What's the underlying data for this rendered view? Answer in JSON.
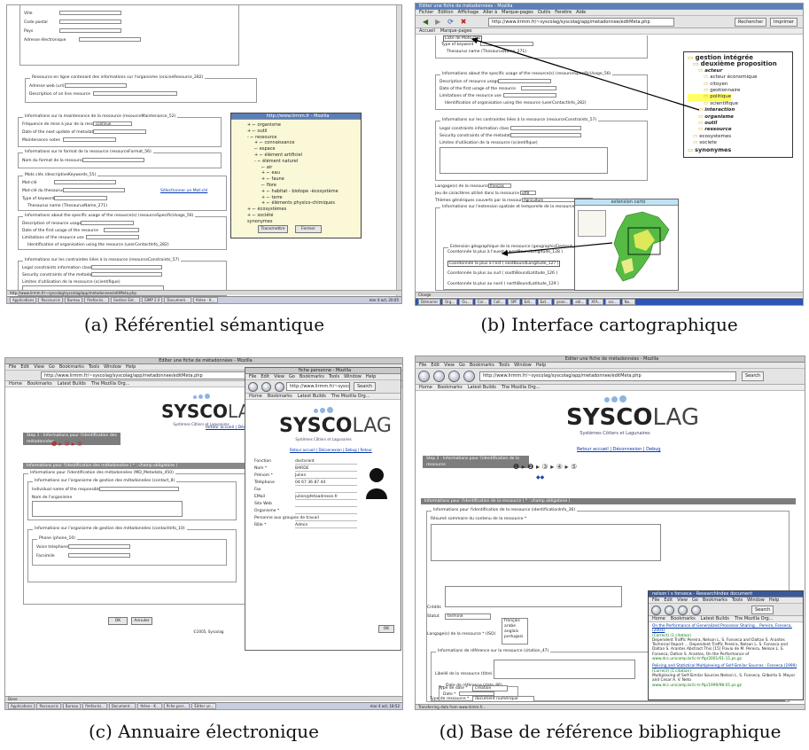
{
  "captions": {
    "a": "(a) Référentiel sémantique",
    "b": "(b) Interface cartographique",
    "c": "(c) Annuaire électronique",
    "d": "(d) Base de référence bibliographique"
  },
  "colors": {
    "link": "#0033aa",
    "titlebar": "#5b7fb8",
    "highlight": "#ffff66",
    "map_green": "#55bb44"
  },
  "browser": {
    "menu": [
      "Fichier",
      "Édition",
      "Affichage",
      "Aller à",
      "Marque-pages",
      "Outils",
      "Fenêtre",
      "Aide"
    ],
    "menu_en": [
      "File",
      "Edit",
      "View",
      "Go",
      "Bookmarks",
      "Tools",
      "Window",
      "Help"
    ],
    "bookmarks": [
      "Home",
      "Bookmarks",
      "Latest Builds",
      "The Mozilla Org..."
    ],
    "search_label": "Search",
    "url_a": "http://www.lirmm.fr/~syscolag/syscolag/app/metadonnee/editMeta.php",
    "url_d": "http://www.lirmm.fr/~syscolag/syscolag/app/metadonnee/editMeta.php"
  },
  "panel_a": {
    "fields_top": [
      "Ville",
      "Code postal",
      "Pays",
      "Adresse électronique"
    ],
    "res_legend": "Ressource en ligne contenant des informations sur l'organisme (onLineResource_282)",
    "res_fields": [
      "Adresse web (url)",
      "Description of on line resource"
    ],
    "maint_legend": "Informations sur la maintenance de la ressource (resourceMaintenance_52)",
    "maint_fields": [
      "Fréquence de mise à jour de la ressource",
      "Date of the next update of metadata",
      "Maintenance notes"
    ],
    "maint_select": "continue",
    "format_legend": "Informations sur le format de la ressource (resourceFormat_56)",
    "format_fields": [
      "Nom du format de la ressource"
    ],
    "kw_legend": "Mots clés (descriptiveKeywords_55)",
    "kw_fields": [
      "Mot-clé",
      "Mot-clé du thesaurus",
      "Type of keyword"
    ],
    "kw_link": "Sélectionner un Mot-clé",
    "thes_legend": "Thesaurus name (ThesaurusName_271)",
    "usage_legend": "Informations about the specific usage of the resource(s) (resourceSpecificUsage_56)",
    "usage_fields": [
      "Description of resource usage",
      "Date of the first usage of the resource",
      "Limitations of the resource use"
    ],
    "contact_legend": "Identification of organisation using the resource (userContactInfo_282)",
    "constr_legend": "Informations sur les contraintes liées à la ressource (resourceConstraints_57)",
    "constr_fields": [
      "Legal constraints information class",
      "Security constraints of the metadata",
      "Limites d'utilisation de la ressource (scientifique)"
    ],
    "popup_title": "http://www.lirmm.fr - Mozilla",
    "tree": [
      "+ ⌐ organisme",
      "+ ⌐ outil",
      "- ⌐ ressource",
      "+ ⌐ connaissance",
      "⌐ espace",
      "+ ⌐ élément artificiel",
      "- ⌐ élément naturel",
      "⌐ air",
      "+ ⌐ eau",
      "+ ⌐ faune",
      "⌐ flore",
      "+ ⌐ habitat - biotope -écosystème",
      "+ ⌐ terre",
      "+ ⌐ éléments physico-chimiques",
      "+ ⌐ écosystèmes",
      "+ ⌐ société",
      "synonymes"
    ],
    "popup_buttons": [
      "Transmettre",
      "Fermer"
    ],
    "taskbar": [
      "Applications",
      "Raccourcis",
      "Bureau",
      "firefox-bi...",
      "Gestion Ext...",
      "GIMP 2.0",
      "Document...",
      "thèse - K..."
    ],
    "clock": "mer 4 oct, 20:05"
  },
  "panel_b": {
    "title": "Éditer une fiche de métadonnées - Mozilla",
    "tb_buttons": [
      "Précédent",
      "Suivant",
      "Actualiser",
      "Arrêter"
    ],
    "tb_right": [
      "Rechercher",
      "Imprimer"
    ],
    "bookmarks": [
      "Accueil",
      "Marque-pages"
    ],
    "field_top": [
      "Liste de Mots-clés",
      "Type of keyword"
    ],
    "thes_legend": "Thesaurus name (ThesaurusName_271)",
    "usage_legend": "Informations about the specific usage of the resource(s) (resourceSpecificUsage_56)",
    "usage_fields": [
      "Description of resource usage",
      "Date of the first usage of the resource",
      "Limitations of the resource use"
    ],
    "contact_legend": "Identification of organisation using the resource (userContactInfo_282)",
    "constr_legend": "Informations sur les contraintes liées à la ressource (resourceConstraints_57)",
    "constr_fields": [
      "Legal constraints information class",
      "Security constraints of the metadata",
      "Limites d'utilisation de la ressource (scientifique)"
    ],
    "lang_fields": [
      "Langage(s) de la ressource",
      "Jeu de caractères utilisé dans la ressource",
      "Thèmes génériques couverts par la ressource"
    ],
    "lang_values": [
      "français",
      "utf8",
      "Agriculture"
    ],
    "extent_legend": "Informations sur l'extension spatiale et temporelle de la ressource (extent_43)",
    "geo_legend": "Extension géographique de la ressource (geographicElement_141)",
    "coords": [
      "Coordonnée la plus à l'ouest ( westBoundLongitude_128 )",
      "Coordonnée la plus à l'est ( eastBoundLongitude_127 )",
      "Coordonnée la plus au sud ( southBoundLatitude_126 )",
      "Coordonnée la plus au nord ( northBoundLatitude_129 )"
    ],
    "map_title": "extension carto",
    "tree": [
      "gestion intégrée",
      "deuxième proposition",
      "acteur",
      "acteur économique",
      "citoyen",
      "gestionnaire",
      "politique",
      "scientifique",
      "interaction",
      "organisme",
      "outil",
      "ressource",
      "ecosystemes",
      "societe",
      "synonymes"
    ],
    "status": "Charge",
    "taskbar": [
      "Démarrer",
      "Org...",
      "Ou...",
      "Cor...",
      "Coll...",
      "SPF",
      "Edi...",
      "Ext...",
      "yeve...",
      "edi...",
      "XFA...",
      "ssc...",
      "No..."
    ]
  },
  "panel_c": {
    "title": "Éditer une fiche de métadonnées - Mozilla",
    "logo_t1": "SYS",
    "logo_t2": "CO",
    "logo_t3": "LAG",
    "logo_sub": "Systèmes Côtiers et Lagunaires",
    "links": [
      "Retour accueil",
      "Déconnexion",
      "Debug"
    ],
    "step_label": "Step 1 : Informations pour l'identification des métadonnées",
    "section_hdr": "Informations pour l'identification des métadonnées ( * : champ obligatoire )",
    "fs1": "Informations pour l'identification des métadonnées (MD_Metadata_450)",
    "fs2": "Informations sur l'organisme de gestion des métadonnées (contact_8)",
    "fs2_fields": [
      "Individual name of the responsible party",
      "Nom de l'organisme"
    ],
    "fs3": "Informations sur l'organisme de gestion des métadonnées (contactInfo_10)",
    "fs4": "Phone (phone_10)",
    "fs4_fields": [
      "Voice telephone",
      "Facsimile"
    ],
    "buttons": [
      "OK",
      "Annuler"
    ],
    "copyright": "©2005, Syscolag",
    "popup_title": "fiche personne - Mozilla",
    "popup_menu": [
      "File",
      "Edit",
      "View",
      "Go",
      "Bookmarks",
      "Tools",
      "Window",
      "Help"
    ],
    "popup_url": "http://www.lirmm.fr/~syscolag/...",
    "popup_links": [
      "Retour accueil",
      "Déconnexion",
      "Debug",
      "Retour"
    ],
    "person_labels": [
      "Fonction",
      "Nom *",
      "Prénom *",
      "Téléphone",
      "Fax",
      "EMail",
      "Site Web",
      "Organisme *",
      "Personne aux groupes de travail",
      "Rôle *"
    ],
    "person_values": [
      "doctorant",
      "BARDE",
      "Julien",
      "04 67 36 87 44",
      "",
      "julien@fetaadresse.fr",
      "",
      "",
      "",
      "Admin"
    ],
    "popup_ok": "OK",
    "taskbar": [
      "Applications",
      "Raccourcis",
      "Bureau",
      "firefox-bi...",
      "Document...",
      "thèse - K...",
      "fiche pers...",
      "Éditer un..."
    ],
    "clock": "mar 4 oct, 18:52"
  },
  "panel_d": {
    "title": "Éditer une fiche de métadonnées - Mozilla",
    "logo_sub": "Systèmes Côtiers et Lagunaires",
    "links": [
      "Retour accueil",
      "Déconnexion",
      "Debug"
    ],
    "step_label": "Step 2 : Informations pour l'identification de la ressource",
    "section_hdr": "Informations pour l'identification de la ressource ( * : champ obligatoire )",
    "fs1": "Informations pour l'identification de la ressource (identificationInfo_36)",
    "resume_label": "Résumé sommaire du contenu de la ressource *",
    "credits_label": "Crédits",
    "statut_label": "Statut",
    "statut_value": "terminé",
    "lang_label": "Langage(s) de la ressource * (ISO)",
    "langs": [
      "français",
      "arabe",
      "anglais",
      "portugais"
    ],
    "cit_legend": "Informations de référence sur la ressource (citation_47)",
    "title_label": "Libellé de la ressource (titre) *",
    "date_legend": "Date de référence (date_86)",
    "date_label": "Date *",
    "datetype_label": "Type de date *",
    "datetype_value": "création",
    "restype_label": "Type de ressource *",
    "restype_value": "document numérique",
    "status": "Transferring data from www.lirmm.fr...",
    "popup_title": "nelson l s fonseca - ResearchIndex document",
    "popup_menu": [
      "File",
      "Edit",
      "View",
      "Go",
      "Bookmarks",
      "Tools",
      "Window",
      "Help"
    ],
    "popup_results": [
      {
        "title": "On the Performance of Generalized Processor Sharing... Pereira, Fonseca, (2001)",
        "meta": "(Correct) (1 citation)",
        "body": "Dependent Traffic Pereira, Nelson L. S. Fonseca and Daltan S. Arantes Technical Report ... Dependent Traffic Pereira, Nelson L. S. Fonseca and Daltan S. Arantes Abstract This [15] Flavio de M. Pereira, Nelson L. S. Fonseca, Dalton S. Arantes, On the Performance of",
        "url": "www.dcc.unicamp.br/ic-tr-ftp/2001/01-11.ps.gz"
      },
      {
        "title": "Policing and Statistical Multiplexing of Self-Similar Sources - Fonseca (1999)",
        "meta": "(Correct) (1 citation)",
        "body": "Multiplexing of Self-Similar Sources Nelson L. S. Fonseca, Gilberto S. Mayor and Cesar A. V. Neto",
        "url": "www.dcc.unicamp.br/ic-tr-ftp/1999/98-01.ps.gz"
      }
    ]
  }
}
